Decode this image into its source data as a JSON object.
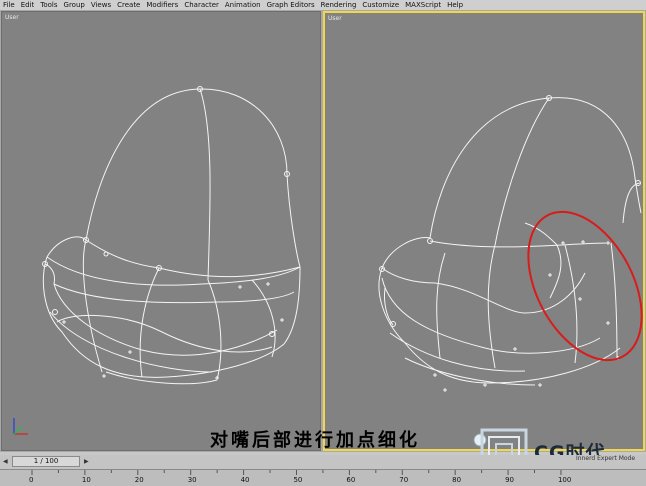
{
  "menu": [
    "File",
    "Edit",
    "Tools",
    "Group",
    "Views",
    "Create",
    "Modifiers",
    "Character",
    "Animation",
    "Graph Editors",
    "Rendering",
    "Customize",
    "MAXScript",
    "Help"
  ],
  "viewports": {
    "left_label": "User",
    "right_label": "User"
  },
  "caption": "对嘴后部进行加点细化",
  "watermark": "CG时代",
  "status": "Innerd Expert Mode",
  "timeline": {
    "frame_display": "1 / 100",
    "ticks": [
      "0",
      "10",
      "20",
      "30",
      "40",
      "50",
      "60",
      "70",
      "80",
      "90",
      "100"
    ]
  },
  "colors": {
    "viewport_bg": "#828282",
    "active_border": "#f0d84a",
    "wire": "#f4f4f4",
    "highlight": "#d81b1b"
  }
}
